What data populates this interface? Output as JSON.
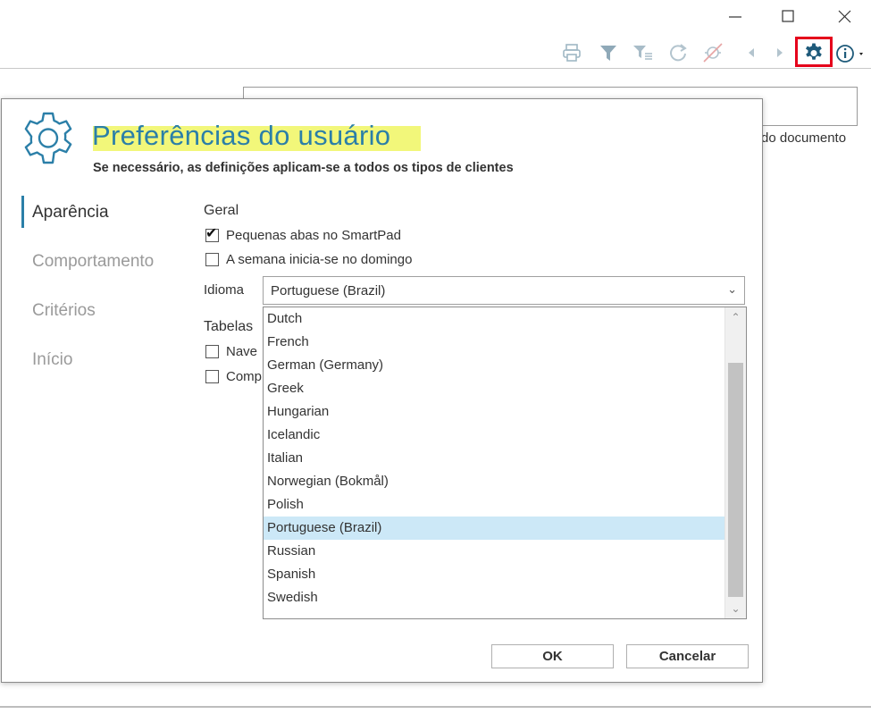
{
  "window": {
    "minimize_icon": "minimize-icon",
    "maximize_icon": "maximize-icon",
    "close_icon": "close-icon"
  },
  "toolbar": {
    "icons": [
      "print-icon",
      "filter-icon",
      "filter-list-icon",
      "refresh-icon",
      "no-location-icon",
      "prev-arrow-icon",
      "next-arrow-icon",
      "gear-icon",
      "info-icon"
    ],
    "highlight_color": "#e5001b"
  },
  "background": {
    "field_label": "do documento"
  },
  "dialog": {
    "title": "Preferências do usuário",
    "subtitle": "Se necessário, as definições aplicam-se a todos os tipos de clientes",
    "accent_color": "#2b7fa8",
    "highlight_color": "#f2f77a",
    "nav": [
      "Aparência",
      "Comportamento",
      "Critérios",
      "Início"
    ],
    "geral_heading": "Geral",
    "opt_small_tabs": "Pequenas abas no SmartPad",
    "opt_small_tabs_checked": true,
    "opt_week_sunday": "A semana inicia-se no domingo",
    "opt_week_sunday_checked": false,
    "idioma_label": "Idioma",
    "idioma_value": "Portuguese (Brazil)",
    "tabelas_heading": "Tabelas",
    "tabelas_opt1": "Nave",
    "tabelas_opt2": "Comp",
    "languages": [
      "Dutch",
      "French",
      "German (Germany)",
      "Greek",
      "Hungarian",
      "Icelandic",
      "Italian",
      "Norwegian (Bokmål)",
      "Polish",
      "Portuguese (Brazil)",
      "Russian",
      "Spanish",
      "Swedish"
    ],
    "selected_language": "Portuguese (Brazil)",
    "ok_label": "OK",
    "cancel_label": "Cancelar"
  }
}
